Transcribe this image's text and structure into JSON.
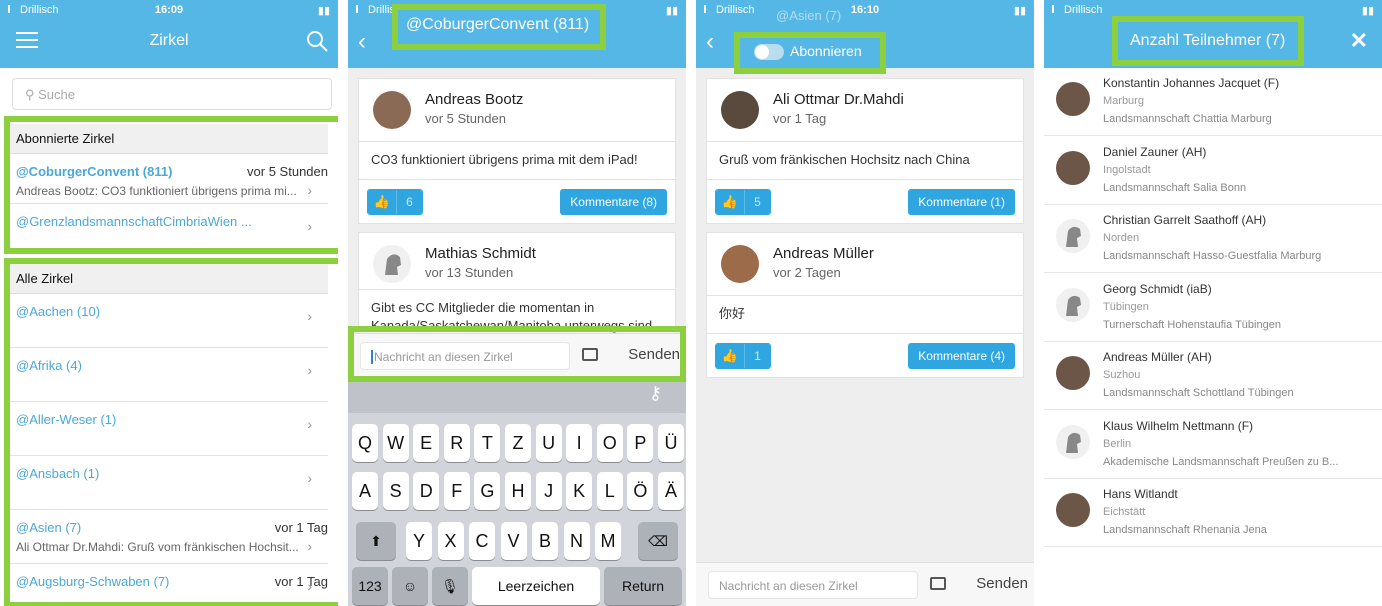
{
  "status": {
    "carrier": "Drillisch",
    "time_1": "16:09",
    "time_3": "16:10"
  },
  "panel1": {
    "title": "Zirkel",
    "search_placeholder": "Suche",
    "subscribed_heading": "Abonnierte Zirkel",
    "subscribed": [
      {
        "name": "@CoburgerConvent (811)",
        "when": "vor 5 Stunden",
        "preview": "Andreas Bootz: CO3 funktioniert übrigens prima mi..."
      },
      {
        "name": "@GrenzlandsmannschaftCimbriaWien ...",
        "when": "",
        "preview": ""
      }
    ],
    "all_heading": "Alle Zirkel",
    "all": [
      {
        "name": "@Aachen (10)",
        "when": "",
        "preview": ""
      },
      {
        "name": "@Afrika (4)",
        "when": "",
        "preview": ""
      },
      {
        "name": "@Aller-Weser (1)",
        "when": "",
        "preview": ""
      },
      {
        "name": "@Ansbach (1)",
        "when": "",
        "preview": ""
      },
      {
        "name": "@Asien (7)",
        "when": "vor 1 Tag",
        "preview": "Ali Ottmar Dr.Mahdi: Gruß vom fränkischen Hochsit..."
      },
      {
        "name": "@Augsburg-Schwaben (7)",
        "when": "vor 1 Tag",
        "preview": ""
      }
    ]
  },
  "panel2": {
    "title": "@CoburgerConvent (811)",
    "posts": [
      {
        "author": "Andreas Bootz",
        "ago": "vor 5 Stunden",
        "text": "CO3 funktioniert übrigens prima mit dem iPad!",
        "likes": "6",
        "comments": "Kommentare (8)"
      },
      {
        "author": "Mathias Schmidt",
        "ago": "vor 13 Stunden",
        "text": "Gibt es CC Mitglieder die momentan in Kanada/Saskatchewan/Manitoba unterwegs sind"
      }
    ],
    "message_placeholder": "Nachricht an diesen Zirkel",
    "send": "Senden",
    "keyboard": {
      "row1": [
        "Q",
        "W",
        "E",
        "R",
        "T",
        "Z",
        "U",
        "I",
        "O",
        "P",
        "Ü"
      ],
      "row2": [
        "A",
        "S",
        "D",
        "F",
        "G",
        "H",
        "J",
        "K",
        "L",
        "Ö",
        "Ä"
      ],
      "row3": [
        "Y",
        "X",
        "C",
        "V",
        "B",
        "N",
        "M"
      ],
      "num": "123",
      "space": "Leerzeichen",
      "return": "Return"
    }
  },
  "panel3": {
    "title": "@Asien (7)",
    "subscribe_label": "Abonnieren",
    "posts": [
      {
        "author": "Ali Ottmar Dr.Mahdi",
        "ago": "vor 1 Tag",
        "text": "Gruß vom fränkischen Hochsitz nach China",
        "likes": "5",
        "comments": "Kommentare (1)"
      },
      {
        "author": "Andreas Müller",
        "ago": "vor 2 Tagen",
        "text": "你好",
        "likes": "1",
        "comments": "Kommentare (4)"
      }
    ],
    "message_placeholder": "Nachricht an diesen Zirkel",
    "send": "Senden"
  },
  "panel4": {
    "title": "Anzahl Teilnehmer (7)",
    "members": [
      {
        "name": "Konstantin Johannes Jacquet (F)",
        "city": "Marburg",
        "org": "Landsmannschaft Chattia Marburg",
        "photo": true
      },
      {
        "name": "Daniel Zauner (AH)",
        "city": "Ingolstadt",
        "org": "Landsmannschaft Salia Bonn",
        "photo": true
      },
      {
        "name": "Christian Garrelt Saathoff (AH)",
        "city": "Norden",
        "org": "Landsmannschaft Hasso-Guestfalia Marburg",
        "photo": false
      },
      {
        "name": "Georg Schmidt (iaB)",
        "city": "Tübingen",
        "org": "Turnerschaft Hohenstaufia Tübingen",
        "photo": false
      },
      {
        "name": "Andreas Müller (AH)",
        "city": "Suzhou",
        "org": "Landsmannschaft Schottland Tübingen",
        "photo": true
      },
      {
        "name": "Klaus Wilhelm Nettmann (F)",
        "city": "Berlin",
        "org": "Akademische Landsmannschaft Preußen zu B...",
        "photo": false
      },
      {
        "name": "Hans Witlandt",
        "city": "Eichstätt",
        "org": "Landsmannschaft Rhenania Jena",
        "photo": true
      }
    ]
  },
  "colors": {
    "nav": "#55b7e6",
    "accent": "#2fa6e0",
    "highlight": "#8ccf3f"
  },
  "icons": [
    "menu-icon",
    "search-icon",
    "back-icon",
    "close-icon",
    "thumbs-up-icon",
    "image-icon",
    "shift-icon",
    "backspace-icon",
    "emoji-icon",
    "mic-icon",
    "key-icon",
    "chevron-right-icon"
  ]
}
